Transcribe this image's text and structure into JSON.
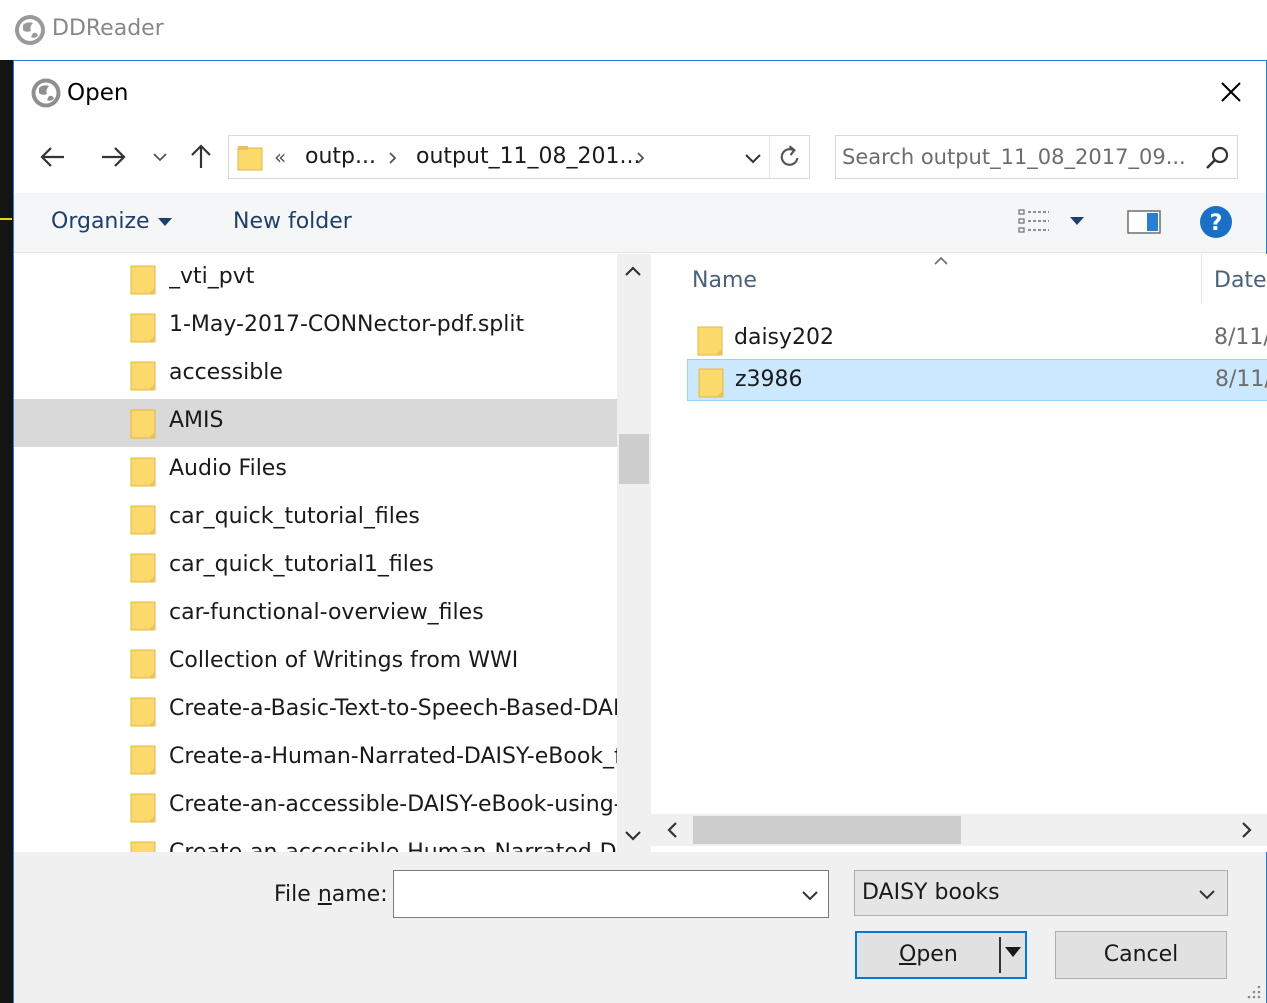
{
  "app": {
    "title": "DDReader",
    "icon": "globe-icon"
  },
  "dialog": {
    "title": "Open",
    "icon": "globe-icon",
    "close_icon": "close-icon"
  },
  "nav": {
    "back_icon": "back-arrow-icon",
    "forward_icon": "forward-arrow-icon",
    "recent_icon": "chevron-down-icon",
    "up_icon": "up-arrow-icon"
  },
  "address": {
    "overflow": "«",
    "crumbs": [
      "outp...",
      "output_11_08_201..."
    ],
    "refresh_icon": "refresh-icon"
  },
  "search": {
    "placeholder": "Search output_11_08_2017_09...",
    "icon": "search-icon"
  },
  "commandbar": {
    "organize": "Organize",
    "new_folder": "New folder",
    "view_icon": "details-view-icon",
    "preview_icon": "preview-pane-icon",
    "help_icon": "help-icon"
  },
  "tree": {
    "items": [
      {
        "label": "_vti_pvt"
      },
      {
        "label": "1-May-2017-CONNector-pdf.split"
      },
      {
        "label": "accessible"
      },
      {
        "label": "AMIS",
        "selected": true
      },
      {
        "label": "Audio Files"
      },
      {
        "label": "car_quick_tutorial_files"
      },
      {
        "label": "car_quick_tutorial1_files"
      },
      {
        "label": "car-functional-overview_files"
      },
      {
        "label": "Collection of Writings from WWI"
      },
      {
        "label": "Create-a-Basic-Text-to-Speech-Based-DAISY"
      },
      {
        "label": "Create-a-Human-Narrated-DAISY-eBook_f"
      },
      {
        "label": "Create-an-accessible-DAISY-eBook-using-"
      },
      {
        "label": "Create-an-accessible-Human-Narrated-DA"
      }
    ]
  },
  "files": {
    "columns": {
      "name": "Name",
      "date": "Date"
    },
    "rows": [
      {
        "name": "daisy202",
        "date": "8/11/"
      },
      {
        "name": "z3986",
        "date": "8/11/",
        "selected": true
      }
    ]
  },
  "bottom": {
    "filename_label_pre": "File ",
    "filename_label_u": "n",
    "filename_label_post": "ame:",
    "filename_value": "",
    "filetype": "DAISY books",
    "open_label_u": "O",
    "open_label_rest": "pen",
    "cancel_label": "Cancel"
  },
  "colors": {
    "accent": "#0078d7",
    "folder": "#fcd96b",
    "selection": "#cce8ff",
    "tree_selection": "#d9d9d9"
  }
}
